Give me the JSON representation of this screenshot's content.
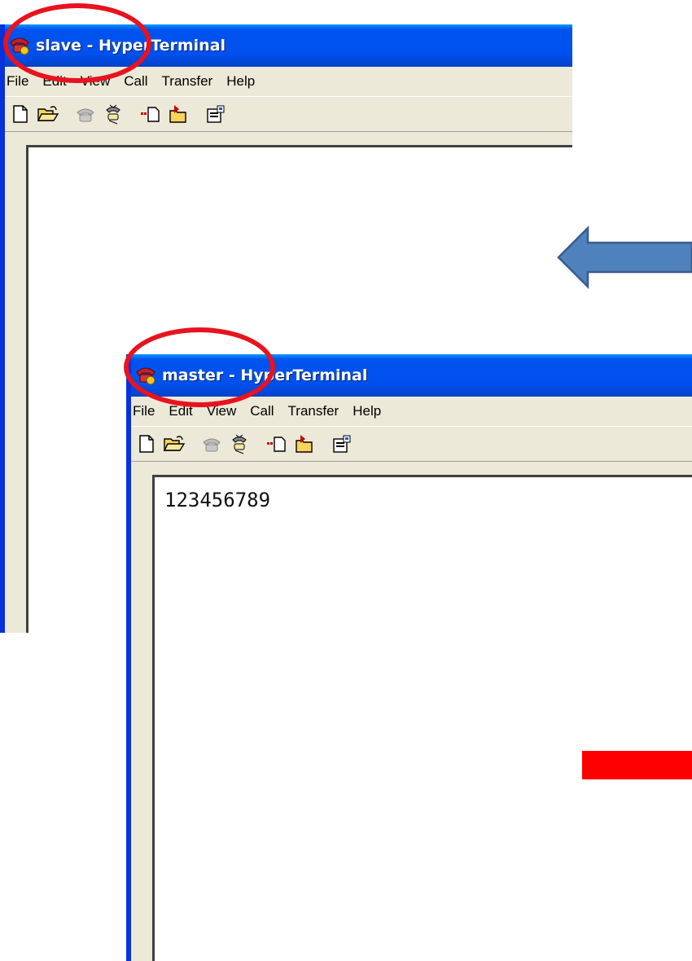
{
  "windows": [
    {
      "id": "slave",
      "title": "slave - HyperTerminal",
      "menu": [
        "File",
        "Edit",
        "View",
        "Call",
        "Transfer",
        "Help"
      ],
      "toolbar_icons": [
        "new-connection-icon",
        "open-icon",
        "disconnect-icon",
        "dial-icon",
        "send-file-icon",
        "receive-file-icon",
        "properties-icon"
      ],
      "terminal_text": ""
    },
    {
      "id": "master",
      "title": "master - HyperTerminal",
      "menu": [
        "File",
        "Edit",
        "View",
        "Call",
        "Transfer",
        "Help"
      ],
      "toolbar_icons": [
        "new-connection-icon",
        "open-icon",
        "disconnect-icon",
        "dial-icon",
        "send-file-icon",
        "receive-file-icon",
        "properties-icon"
      ],
      "terminal_text": "123456789"
    }
  ],
  "annotations": {
    "ellipse_color": "#e8131f",
    "arrow_color": "#4f81bd",
    "bar_color": "#ff0000"
  },
  "colors": {
    "titlebar": "#0053ee",
    "window_face": "#ece9d8"
  }
}
